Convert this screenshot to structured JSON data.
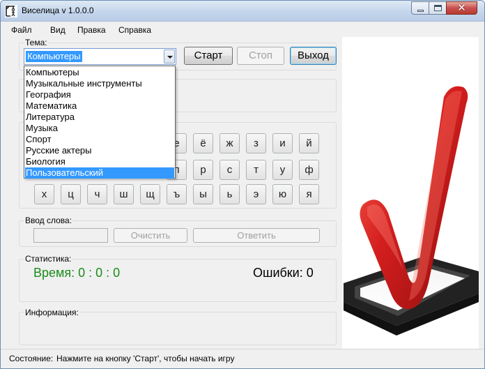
{
  "window": {
    "title": "Виселица v 1.0.0.0",
    "controls": {
      "minimize": "minimize",
      "maximize": "maximize",
      "close": "✕"
    }
  },
  "menu": [
    "Файл",
    "Вид",
    "Правка",
    "Справка"
  ],
  "theme": {
    "label": "Тема:",
    "selected": "Компьютеры",
    "options": [
      "Компьютеры",
      "Музыкальные инструменты",
      "География",
      "Математика",
      "Литература",
      "Музыка",
      "Спорт",
      "Русские актеры",
      "Биология",
      "Пользовательский"
    ],
    "highlighted_option": "Пользовательский"
  },
  "buttons": {
    "start": "Старт",
    "stop": "Стоп",
    "exit": "Выход"
  },
  "letters": {
    "row1": [
      "е",
      "ё",
      "ж",
      "з",
      "и",
      "й"
    ],
    "row2": [
      "п",
      "р",
      "с",
      "т",
      "у",
      "ф"
    ],
    "row3": [
      "х",
      "ц",
      "ч",
      "ш",
      "щ",
      "ъ",
      "ы",
      "ь",
      "э",
      "ю",
      "я"
    ]
  },
  "word_input": {
    "label": "Ввод слова:",
    "value": "",
    "clear": "Очистить",
    "answer": "Ответить"
  },
  "stats": {
    "label": "Статистика:",
    "time": "Время: 0 : 0 : 0",
    "errors": "Ошибки: 0"
  },
  "info": {
    "label": "Информация:"
  },
  "status": {
    "label": "Состояние:",
    "text": "Нажмите на кнопку 'Старт', чтобы начать игру"
  },
  "colors": {
    "selection": "#3399ff",
    "time_text": "#1a8c1a",
    "check_mark": "#c41a1a"
  },
  "icons": [
    "app-icon",
    "dropdown-arrow-icon",
    "checkmark-image"
  ]
}
